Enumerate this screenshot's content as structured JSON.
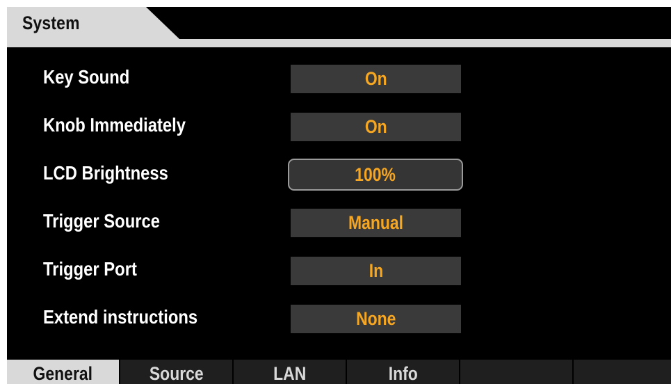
{
  "header": {
    "title": "System"
  },
  "settings": [
    {
      "label": "Key Sound",
      "value": "On"
    },
    {
      "label": "Knob Immediately",
      "value": "On"
    },
    {
      "label": "LCD Brightness",
      "value": "100%"
    },
    {
      "label": "Trigger Source",
      "value": "Manual"
    },
    {
      "label": "Trigger Port",
      "value": "In"
    },
    {
      "label": "Extend instructions",
      "value": "None"
    }
  ],
  "selected_setting": "LCD Brightness",
  "tabs": [
    {
      "label": "General",
      "active": true
    },
    {
      "label": "Source",
      "active": false
    },
    {
      "label": "LAN",
      "active": false
    },
    {
      "label": "Info",
      "active": false
    },
    {
      "label": "",
      "active": false
    },
    {
      "label": "",
      "active": false
    }
  ],
  "colors": {
    "value_text": "#f5a623",
    "value_box": "#3a3a3a",
    "header_tab": "#d9d9d9",
    "background": "#000000"
  }
}
